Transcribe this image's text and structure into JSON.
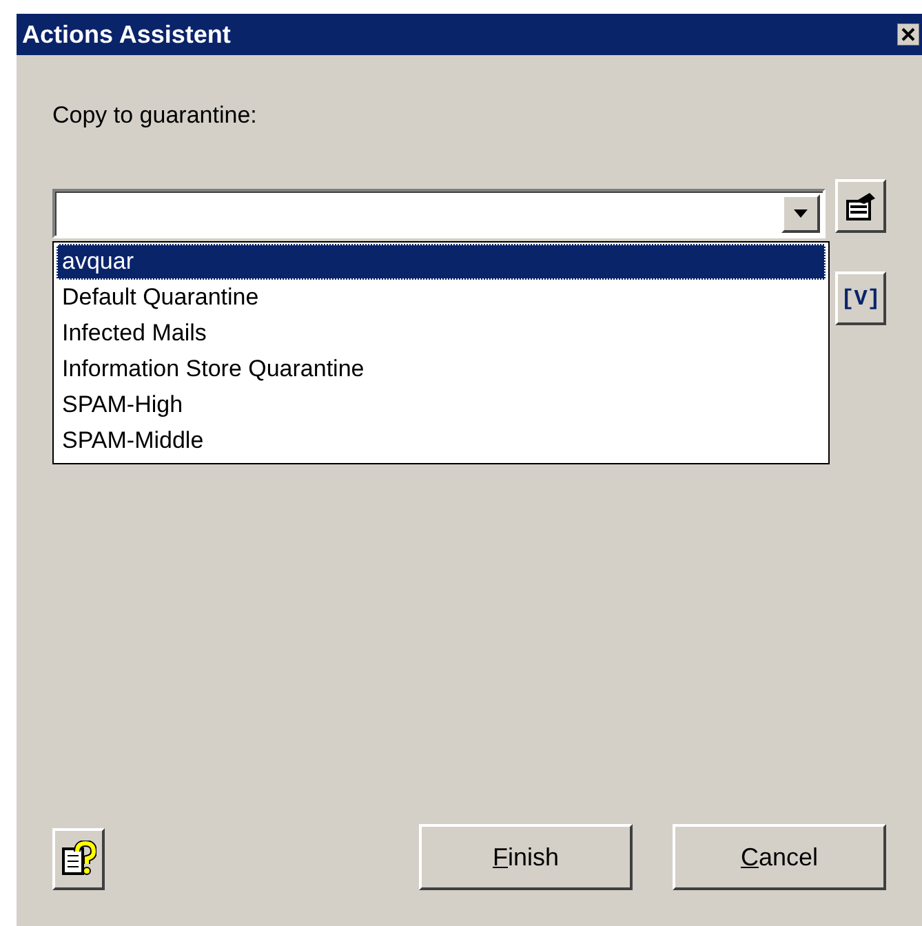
{
  "window": {
    "title": "Actions Assistent"
  },
  "label": "Copy to guarantine:",
  "combo": {
    "open": true
  },
  "dropdown_items": [
    {
      "label": "avquar",
      "selected": true
    },
    {
      "label": "Default Quarantine",
      "selected": false
    },
    {
      "label": "Infected Mails",
      "selected": false
    },
    {
      "label": "Information Store Quarantine",
      "selected": false
    },
    {
      "label": "SPAM-High",
      "selected": false
    },
    {
      "label": "SPAM-Middle",
      "selected": false
    }
  ],
  "variable_button": "[V]",
  "buttons": [
    {
      "access_key": "F",
      "rest": "inish"
    },
    {
      "access_key": "C",
      "rest": "ancel"
    }
  ]
}
